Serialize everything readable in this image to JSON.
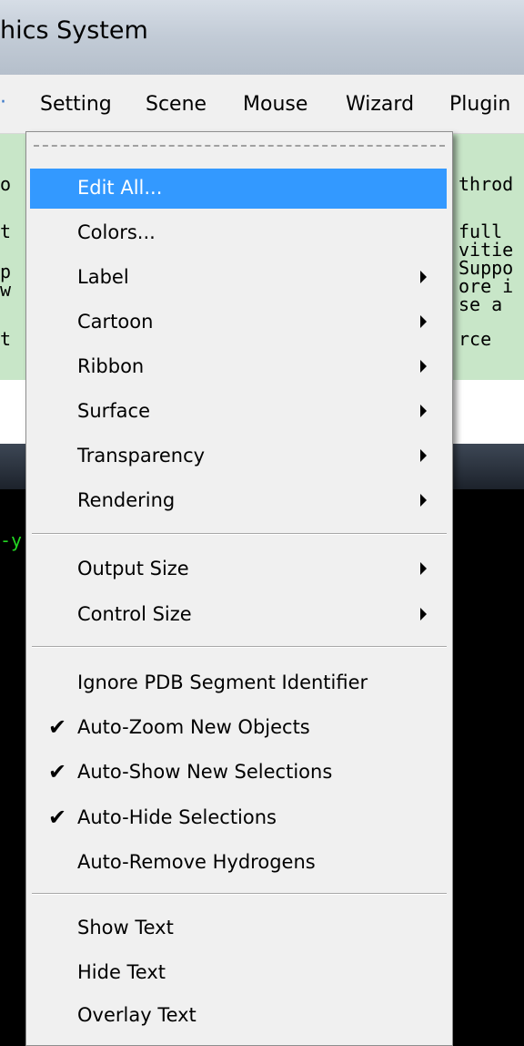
{
  "window": {
    "title": "hics System"
  },
  "menubar": {
    "items": [
      {
        "label": "Setting"
      },
      {
        "label": "Scene"
      },
      {
        "label": "Mouse"
      },
      {
        "label": "Wizard"
      },
      {
        "label": "Plugin"
      }
    ]
  },
  "background_text": {
    "left": [
      "o",
      "t",
      "",
      "p",
      "w",
      "t"
    ],
    "right": [
      "throd",
      "full",
      "vitie",
      "Suppo",
      "ore i",
      "se a",
      "rce"
    ],
    "console_left": "-y"
  },
  "setting_menu": {
    "groups": [
      [
        {
          "label": "Edit All...",
          "submenu": false,
          "checked": false,
          "highlighted": true
        },
        {
          "label": "Colors...",
          "submenu": false,
          "checked": false
        },
        {
          "label": "Label",
          "submenu": true,
          "checked": false
        },
        {
          "label": "Cartoon",
          "submenu": true,
          "checked": false
        },
        {
          "label": "Ribbon",
          "submenu": true,
          "checked": false
        },
        {
          "label": "Surface",
          "submenu": true,
          "checked": false
        },
        {
          "label": "Transparency",
          "submenu": true,
          "checked": false
        },
        {
          "label": "Rendering",
          "submenu": true,
          "checked": false
        }
      ],
      [
        {
          "label": "Output Size",
          "submenu": true,
          "checked": false
        },
        {
          "label": "Control Size",
          "submenu": true,
          "checked": false
        }
      ],
      [
        {
          "label": "Ignore PDB Segment Identifier",
          "submenu": false,
          "checked": false
        },
        {
          "label": "Auto-Zoom New Objects",
          "submenu": false,
          "checked": true
        },
        {
          "label": "Auto-Show New Selections",
          "submenu": false,
          "checked": true
        },
        {
          "label": "Auto-Hide Selections",
          "submenu": false,
          "checked": true
        },
        {
          "label": "Auto-Remove Hydrogens",
          "submenu": false,
          "checked": false
        }
      ],
      [
        {
          "label": "Show Text",
          "submenu": false,
          "checked": false
        },
        {
          "label": "Hide Text",
          "submenu": false,
          "checked": false
        },
        {
          "label": "Overlay Text",
          "submenu": false,
          "checked": false
        }
      ]
    ]
  },
  "colors": {
    "highlight": "#3399ff",
    "panel_green": "#c8e6c8",
    "console_green": "#23d623"
  }
}
